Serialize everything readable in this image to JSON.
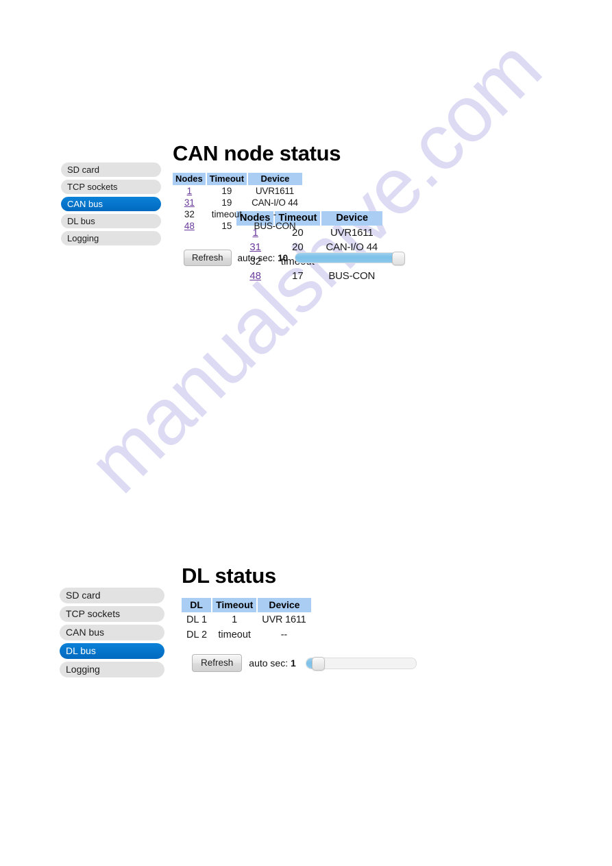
{
  "watermark": {
    "text": "manualshive.com"
  },
  "colors": {
    "menu_active": "#0076ce",
    "table_header": "#aacdf4",
    "link": "#6a3a9c",
    "slider_fill": "#7cc0e8"
  },
  "sections": [
    {
      "title": "CAN node status",
      "menu": [
        {
          "label": "SD card",
          "active": false
        },
        {
          "label": "TCP sockets",
          "active": false
        },
        {
          "label": "CAN bus",
          "active": true
        },
        {
          "label": "DL bus",
          "active": false
        },
        {
          "label": "Logging",
          "active": false
        }
      ],
      "table": {
        "headers": [
          "Nodes",
          "Timeout",
          "Device"
        ],
        "rows": [
          {
            "node": "1",
            "link": true,
            "timeout": "19",
            "device": "UVR1611"
          },
          {
            "node": "31",
            "link": true,
            "timeout": "19",
            "device": "CAN-I/O 44"
          },
          {
            "node": "32",
            "link": false,
            "timeout": "timeout",
            "device": "-"
          },
          {
            "node": "48",
            "link": true,
            "timeout": "15",
            "device": "BUS-CON"
          }
        ]
      },
      "controls": {
        "refresh_label": "Refresh",
        "auto_label": "auto sec:",
        "auto_value": "10",
        "slider_percent": 100
      }
    },
    {
      "title": "DL status",
      "menu": [
        {
          "label": "SD card",
          "active": false
        },
        {
          "label": "TCP sockets",
          "active": false
        },
        {
          "label": "CAN bus",
          "active": false
        },
        {
          "label": "DL bus",
          "active": true
        },
        {
          "label": "Logging",
          "active": false
        }
      ],
      "table": {
        "headers": [
          "DL",
          "Timeout",
          "Device"
        ],
        "rows": [
          {
            "node": "DL 1",
            "link": false,
            "timeout": "1",
            "device": "UVR 1611"
          },
          {
            "node": "DL 2",
            "link": false,
            "timeout": "timeout",
            "device": "--"
          }
        ]
      },
      "controls": {
        "refresh_label": "Refresh",
        "auto_label": "auto sec:",
        "auto_value": "1",
        "slider_percent": 6
      }
    }
  ],
  "standalone_table": {
    "headers": [
      "Nodes",
      "Timeout",
      "Device"
    ],
    "rows": [
      {
        "node": "1",
        "link": true,
        "timeout": "20",
        "device": "UVR1611"
      },
      {
        "node": "31",
        "link": true,
        "timeout": "20",
        "device": "CAN-I/O 44"
      },
      {
        "node": "32",
        "link": false,
        "timeout": "timeout",
        "device": "-"
      },
      {
        "node": "48",
        "link": true,
        "timeout": "17",
        "device": "BUS-CON"
      }
    ]
  }
}
